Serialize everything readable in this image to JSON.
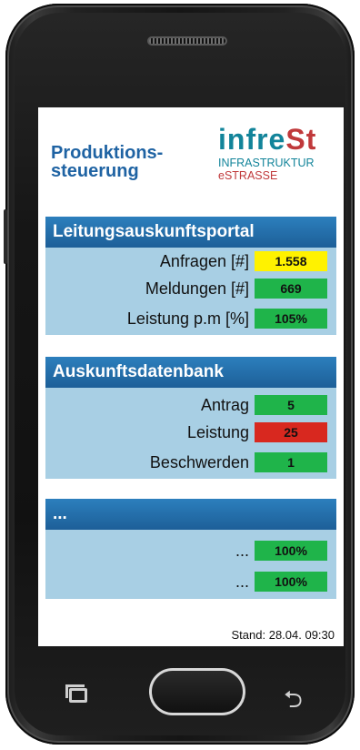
{
  "header": {
    "title": "Produktions-\nsteuerung",
    "logo": {
      "part_a": "infre",
      "part_b": "St",
      "line1": "INFRASTRUKTUR",
      "line2": "eSTRASSE"
    }
  },
  "sections": [
    {
      "title": "Leitungsauskunftsportal",
      "rows": [
        {
          "label": "Anfragen [#]",
          "value": "1.558",
          "status": "yellow"
        },
        {
          "label": "Meldungen [#]",
          "value": "669",
          "status": "green"
        },
        {
          "label": "Leistung p.m [%]",
          "value": "105%",
          "status": "green"
        }
      ]
    },
    {
      "title": "Auskunftsdatenbank",
      "rows": [
        {
          "label": "Antrag",
          "value": "5",
          "status": "green"
        },
        {
          "label": "Leistung",
          "value": "25",
          "status": "red"
        },
        {
          "label": "Beschwerden",
          "value": "1",
          "status": "green"
        }
      ]
    },
    {
      "title": "...",
      "rows": [
        {
          "label": "...",
          "value": "100%",
          "status": "green"
        },
        {
          "label": "...",
          "value": "100%",
          "status": "green"
        }
      ]
    }
  ],
  "footer": {
    "stand": "Stand: 28.04. 09:30"
  },
  "colors": {
    "accent": "#1f63a3",
    "header_bar": "#1d5f98",
    "panel": "#a8cfe4",
    "yellow": "#fff200",
    "green": "#1fb44a",
    "red": "#d8281f"
  },
  "icons": {
    "recent": "recent-apps-icon",
    "back": "back-icon"
  }
}
